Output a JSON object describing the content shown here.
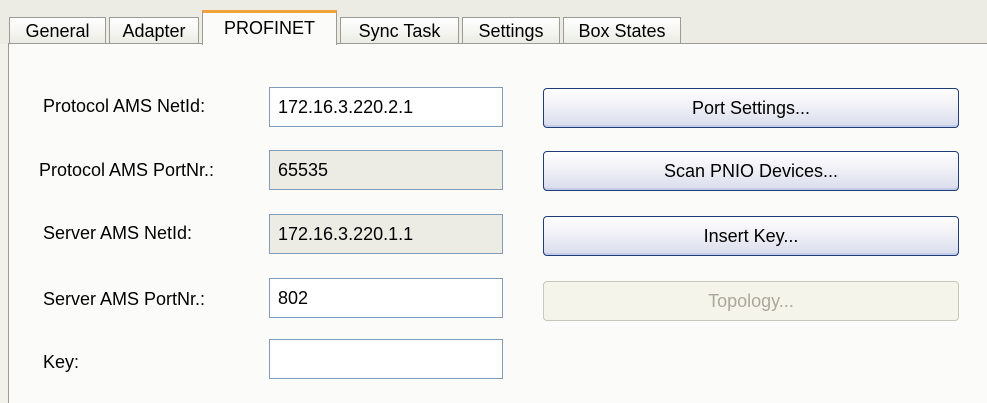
{
  "tabs": [
    {
      "label": "General"
    },
    {
      "label": "Adapter"
    },
    {
      "label": "PROFINET"
    },
    {
      "label": "Sync Task"
    },
    {
      "label": "Settings"
    },
    {
      "label": "Box States"
    }
  ],
  "active_tab": "PROFINET",
  "form": {
    "protocol_ams_netid": {
      "label": "Protocol AMS NetId:",
      "value": "172.16.3.220.2.1"
    },
    "protocol_ams_portnr": {
      "label": "Protocol AMS PortNr.:",
      "value": "65535"
    },
    "server_ams_netid": {
      "label": "Server AMS NetId:",
      "value": "172.16.3.220.1.1"
    },
    "server_ams_portnr": {
      "label": "Server AMS PortNr.:",
      "value": "802"
    },
    "key": {
      "label": "Key:",
      "value": ""
    }
  },
  "buttons": {
    "port_settings": "Port Settings...",
    "scan_pnio_devices": "Scan PNIO Devices...",
    "insert_key": "Insert Key...",
    "topology": "Topology..."
  },
  "colors": {
    "active_tab_accent": "#f0a23a",
    "button_border": "#1f3c7a",
    "disabled_text": "#aaa89b"
  }
}
